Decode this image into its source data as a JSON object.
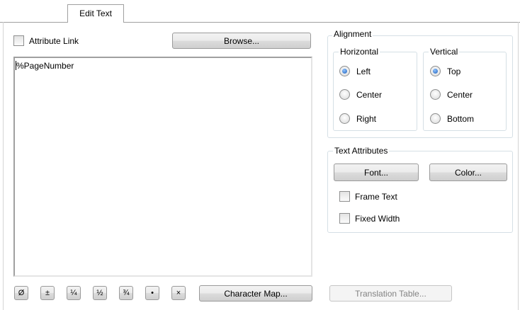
{
  "tab": {
    "label": "Edit Text"
  },
  "attribute_link": {
    "label": "Attribute Link",
    "checked": false
  },
  "browse_button": {
    "label": "Browse..."
  },
  "editor": {
    "text": "%PageNumber"
  },
  "alignment": {
    "title": "Alignment",
    "horizontal": {
      "title": "Horizontal",
      "options": [
        "Left",
        "Center",
        "Right"
      ],
      "selected": "Left"
    },
    "vertical": {
      "title": "Vertical",
      "options": [
        "Top",
        "Center",
        "Bottom"
      ],
      "selected": "Top"
    }
  },
  "text_attributes": {
    "title": "Text Attributes",
    "font_button": "Font...",
    "color_button": "Color...",
    "frame_text": {
      "label": "Frame Text",
      "checked": false
    },
    "fixed_width": {
      "label": "Fixed Width",
      "checked": false
    }
  },
  "symbol_buttons": [
    "Ø",
    "±",
    "¼",
    "½",
    "¾",
    "•",
    "×"
  ],
  "character_map_button": "Character Map...",
  "translation_table_button": {
    "label": "Translation Table...",
    "enabled": false
  }
}
